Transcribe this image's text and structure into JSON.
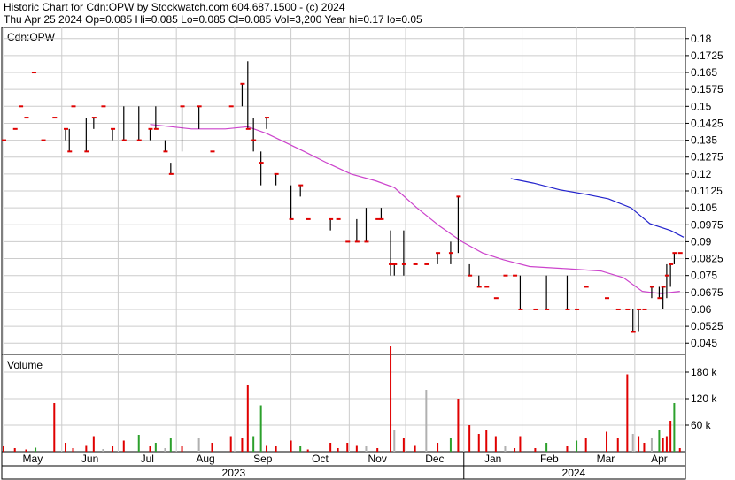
{
  "header": {
    "line1": "Historic Chart for Cdn:OPW by Stockwatch.com 604.687.1500 - (c) 2024",
    "line2": "Thu Apr 25 2024  Op=0.085  Hi=0.085  Lo=0.085  Cl=0.085  Vol=3,200  Year hi=0.17  lo=0.05"
  },
  "price_panel": {
    "symbol_label": "Cdn:OPW"
  },
  "volume_panel": {
    "title": "Volume"
  },
  "colors": {
    "up_volume": "#2ca02c",
    "down_volume": "#e00000",
    "flat_volume": "#b0b0b0",
    "price_bar": "#000000",
    "close_tick": "#e00000",
    "ma_short": "#cc44cc",
    "ma_long": "#2222cc"
  },
  "chart_data": [
    {
      "type": "ohlc",
      "title": "Historic Chart for Cdn:OPW",
      "x_months": [
        "May",
        "Jun",
        "Jul",
        "Aug",
        "Sep",
        "Oct",
        "Nov",
        "Dec",
        "Jan",
        "Feb",
        "Mar",
        "Apr"
      ],
      "x_years": [
        "2023",
        "2024"
      ],
      "y_ticks": [
        "0.18",
        "0.1725",
        "0.165",
        "0.1575",
        "0.15",
        "0.1425",
        "0.135",
        "0.1275",
        "0.12",
        "0.1125",
        "0.105",
        "0.0975",
        "0.09",
        "0.0825",
        "0.075",
        "0.0675",
        "0.06",
        "0.0525",
        "0.045"
      ],
      "ylim": [
        0.04,
        0.185
      ],
      "grid": true,
      "bars": [
        {
          "d": 0,
          "h": 0.135,
          "l": 0.135,
          "c": 0.135
        },
        {
          "d": 6,
          "h": 0.14,
          "l": 0.14,
          "c": 0.14
        },
        {
          "d": 9,
          "h": 0.15,
          "l": 0.15,
          "c": 0.15
        },
        {
          "d": 12,
          "h": 0.145,
          "l": 0.145,
          "c": 0.145
        },
        {
          "d": 16,
          "h": 0.165,
          "l": 0.165,
          "c": 0.165
        },
        {
          "d": 21,
          "h": 0.135,
          "l": 0.135,
          "c": 0.135
        },
        {
          "d": 27,
          "h": 0.145,
          "l": 0.145,
          "c": 0.145
        },
        {
          "d": 33,
          "h": 0.14,
          "l": 0.135,
          "c": 0.14
        },
        {
          "d": 35,
          "h": 0.14,
          "l": 0.13,
          "c": 0.13
        },
        {
          "d": 37,
          "h": 0.15,
          "l": 0.15,
          "c": 0.15
        },
        {
          "d": 44,
          "h": 0.145,
          "l": 0.13,
          "c": 0.13
        },
        {
          "d": 48,
          "h": 0.145,
          "l": 0.14,
          "c": 0.145
        },
        {
          "d": 53,
          "h": 0.15,
          "l": 0.15,
          "c": 0.15
        },
        {
          "d": 58,
          "h": 0.14,
          "l": 0.135,
          "c": 0.14
        },
        {
          "d": 64,
          "h": 0.15,
          "l": 0.135,
          "c": 0.135
        },
        {
          "d": 72,
          "h": 0.15,
          "l": 0.135,
          "c": 0.135
        },
        {
          "d": 78,
          "h": 0.14,
          "l": 0.135,
          "c": 0.14
        },
        {
          "d": 81,
          "h": 0.15,
          "l": 0.14,
          "c": 0.14
        },
        {
          "d": 86,
          "h": 0.135,
          "l": 0.13,
          "c": 0.13
        },
        {
          "d": 89,
          "h": 0.125,
          "l": 0.12,
          "c": 0.12
        },
        {
          "d": 95,
          "h": 0.15,
          "l": 0.13,
          "c": 0.15
        },
        {
          "d": 104,
          "h": 0.15,
          "l": 0.14,
          "c": 0.15
        },
        {
          "d": 111,
          "h": 0.13,
          "l": 0.13,
          "c": 0.13
        },
        {
          "d": 121,
          "h": 0.15,
          "l": 0.15,
          "c": 0.15
        },
        {
          "d": 127,
          "h": 0.16,
          "l": 0.15,
          "c": 0.16
        },
        {
          "d": 130,
          "h": 0.17,
          "l": 0.14,
          "c": 0.14
        },
        {
          "d": 133,
          "h": 0.145,
          "l": 0.13,
          "c": 0.135
        },
        {
          "d": 137,
          "h": 0.13,
          "l": 0.115,
          "c": 0.125
        },
        {
          "d": 140,
          "h": 0.145,
          "l": 0.14,
          "c": 0.145
        },
        {
          "d": 145,
          "h": 0.12,
          "l": 0.115,
          "c": 0.12
        },
        {
          "d": 153,
          "h": 0.115,
          "l": 0.1,
          "c": 0.1
        },
        {
          "d": 158,
          "h": 0.115,
          "l": 0.11,
          "c": 0.115
        },
        {
          "d": 162,
          "h": 0.1,
          "l": 0.1,
          "c": 0.1
        },
        {
          "d": 174,
          "h": 0.1,
          "l": 0.095,
          "c": 0.1
        },
        {
          "d": 178,
          "h": 0.1,
          "l": 0.1,
          "c": 0.1
        },
        {
          "d": 183,
          "h": 0.09,
          "l": 0.09,
          "c": 0.09
        },
        {
          "d": 188,
          "h": 0.1,
          "l": 0.09,
          "c": 0.09
        },
        {
          "d": 193,
          "h": 0.105,
          "l": 0.09,
          "c": 0.09
        },
        {
          "d": 199,
          "h": 0.1,
          "l": 0.1,
          "c": 0.1
        },
        {
          "d": 201,
          "h": 0.105,
          "l": 0.1,
          "c": 0.1
        },
        {
          "d": 206,
          "h": 0.095,
          "l": 0.075,
          "c": 0.08
        },
        {
          "d": 208,
          "h": 0.08,
          "l": 0.075,
          "c": 0.08
        },
        {
          "d": 213,
          "h": 0.095,
          "l": 0.075,
          "c": 0.08
        },
        {
          "d": 219,
          "h": 0.08,
          "l": 0.08,
          "c": 0.08
        },
        {
          "d": 225,
          "h": 0.08,
          "l": 0.08,
          "c": 0.08
        },
        {
          "d": 231,
          "h": 0.085,
          "l": 0.08,
          "c": 0.085
        },
        {
          "d": 238,
          "h": 0.09,
          "l": 0.08,
          "c": 0.085
        },
        {
          "d": 242,
          "h": 0.11,
          "l": 0.085,
          "c": 0.11
        },
        {
          "d": 248,
          "h": 0.08,
          "l": 0.075,
          "c": 0.075
        },
        {
          "d": 253,
          "h": 0.075,
          "l": 0.07,
          "c": 0.07
        },
        {
          "d": 257,
          "h": 0.07,
          "l": 0.07,
          "c": 0.07
        },
        {
          "d": 262,
          "h": 0.065,
          "l": 0.065,
          "c": 0.065
        },
        {
          "d": 267,
          "h": 0.075,
          "l": 0.075,
          "c": 0.075
        },
        {
          "d": 272,
          "h": 0.075,
          "l": 0.075,
          "c": 0.075
        },
        {
          "d": 275,
          "h": 0.075,
          "l": 0.06,
          "c": 0.06
        },
        {
          "d": 283,
          "h": 0.06,
          "l": 0.06,
          "c": 0.06
        },
        {
          "d": 289,
          "h": 0.075,
          "l": 0.06,
          "c": 0.06
        },
        {
          "d": 300,
          "h": 0.075,
          "l": 0.06,
          "c": 0.06
        },
        {
          "d": 305,
          "h": 0.06,
          "l": 0.06,
          "c": 0.06
        },
        {
          "d": 310,
          "h": 0.07,
          "l": 0.07,
          "c": 0.07
        },
        {
          "d": 321,
          "h": 0.065,
          "l": 0.065,
          "c": 0.065
        },
        {
          "d": 327,
          "h": 0.06,
          "l": 0.06,
          "c": 0.06
        },
        {
          "d": 332,
          "h": 0.06,
          "l": 0.06,
          "c": 0.06
        },
        {
          "d": 335,
          "h": 0.06,
          "l": 0.05,
          "c": 0.05
        },
        {
          "d": 338,
          "h": 0.06,
          "l": 0.05,
          "c": 0.06
        },
        {
          "d": 341,
          "h": 0.06,
          "l": 0.06,
          "c": 0.06
        },
        {
          "d": 345,
          "h": 0.07,
          "l": 0.065,
          "c": 0.07
        },
        {
          "d": 349,
          "h": 0.07,
          "l": 0.065,
          "c": 0.065
        },
        {
          "d": 351,
          "h": 0.07,
          "l": 0.06,
          "c": 0.07
        },
        {
          "d": 353,
          "h": 0.08,
          "l": 0.065,
          "c": 0.075
        },
        {
          "d": 355,
          "h": 0.08,
          "l": 0.07,
          "c": 0.08
        },
        {
          "d": 357,
          "h": 0.085,
          "l": 0.08,
          "c": 0.085
        },
        {
          "d": 360,
          "h": 0.085,
          "l": 0.085,
          "c": 0.085
        }
      ],
      "moving_averages": [
        {
          "points": [
            [
              78,
              0.142
            ],
            [
              100,
              0.14
            ],
            [
              118,
              0.14
            ],
            [
              130,
              0.141
            ],
            [
              140,
              0.138
            ],
            [
              150,
              0.134
            ],
            [
              160,
              0.13
            ],
            [
              172,
              0.125
            ],
            [
              185,
              0.12
            ],
            [
              198,
              0.117
            ],
            [
              208,
              0.114
            ],
            [
              220,
              0.105
            ],
            [
              232,
              0.097
            ],
            [
              244,
              0.09
            ],
            [
              255,
              0.085
            ],
            [
              266,
              0.082
            ],
            [
              280,
              0.079
            ],
            [
              300,
              0.078
            ],
            [
              318,
              0.077
            ],
            [
              330,
              0.074
            ],
            [
              340,
              0.068
            ],
            [
              350,
              0.067
            ],
            [
              360,
              0.068
            ]
          ]
        },
        {
          "points": [
            [
              270,
              0.118
            ],
            [
              282,
              0.116
            ],
            [
              296,
              0.113
            ],
            [
              310,
              0.111
            ],
            [
              322,
              0.109
            ],
            [
              334,
              0.105
            ],
            [
              344,
              0.098
            ],
            [
              355,
              0.095
            ],
            [
              362,
              0.092
            ]
          ]
        }
      ]
    },
    {
      "type": "bar",
      "title": "Volume",
      "y_ticks": [
        "180 k",
        "120 k",
        "60 k"
      ],
      "ylim": [
        0,
        220000
      ],
      "bars": [
        {
          "d": 0,
          "v": 12000,
          "k": "down"
        },
        {
          "d": 6,
          "v": 8000,
          "k": "down"
        },
        {
          "d": 12,
          "v": 5000,
          "k": "down"
        },
        {
          "d": 17,
          "v": 9000,
          "k": "up"
        },
        {
          "d": 27,
          "v": 110000,
          "k": "down"
        },
        {
          "d": 33,
          "v": 20000,
          "k": "down"
        },
        {
          "d": 37,
          "v": 8000,
          "k": "down"
        },
        {
          "d": 44,
          "v": 15000,
          "k": "down"
        },
        {
          "d": 48,
          "v": 35000,
          "k": "down"
        },
        {
          "d": 53,
          "v": 6000,
          "k": "flat"
        },
        {
          "d": 58,
          "v": 12000,
          "k": "down"
        },
        {
          "d": 64,
          "v": 25000,
          "k": "down"
        },
        {
          "d": 72,
          "v": 38000,
          "k": "up"
        },
        {
          "d": 78,
          "v": 12000,
          "k": "down"
        },
        {
          "d": 81,
          "v": 20000,
          "k": "up"
        },
        {
          "d": 86,
          "v": 8000,
          "k": "flat"
        },
        {
          "d": 89,
          "v": 30000,
          "k": "up"
        },
        {
          "d": 95,
          "v": 12000,
          "k": "down"
        },
        {
          "d": 104,
          "v": 30000,
          "k": "flat"
        },
        {
          "d": 111,
          "v": 20000,
          "k": "down"
        },
        {
          "d": 121,
          "v": 35000,
          "k": "down"
        },
        {
          "d": 127,
          "v": 30000,
          "k": "down"
        },
        {
          "d": 130,
          "v": 150000,
          "k": "down"
        },
        {
          "d": 133,
          "v": 35000,
          "k": "up"
        },
        {
          "d": 137,
          "v": 105000,
          "k": "up"
        },
        {
          "d": 140,
          "v": 15000,
          "k": "down"
        },
        {
          "d": 145,
          "v": 12000,
          "k": "down"
        },
        {
          "d": 153,
          "v": 25000,
          "k": "down"
        },
        {
          "d": 158,
          "v": 12000,
          "k": "up"
        },
        {
          "d": 162,
          "v": 5000,
          "k": "down"
        },
        {
          "d": 174,
          "v": 20000,
          "k": "down"
        },
        {
          "d": 178,
          "v": 8000,
          "k": "down"
        },
        {
          "d": 183,
          "v": 20000,
          "k": "down"
        },
        {
          "d": 188,
          "v": 15000,
          "k": "down"
        },
        {
          "d": 193,
          "v": 12000,
          "k": "flat"
        },
        {
          "d": 199,
          "v": 8000,
          "k": "down"
        },
        {
          "d": 206,
          "v": 240000,
          "k": "down"
        },
        {
          "d": 208,
          "v": 50000,
          "k": "flat"
        },
        {
          "d": 213,
          "v": 30000,
          "k": "down"
        },
        {
          "d": 219,
          "v": 15000,
          "k": "down"
        },
        {
          "d": 225,
          "v": 140000,
          "k": "flat"
        },
        {
          "d": 231,
          "v": 20000,
          "k": "down"
        },
        {
          "d": 238,
          "v": 30000,
          "k": "up"
        },
        {
          "d": 242,
          "v": 120000,
          "k": "down"
        },
        {
          "d": 248,
          "v": 60000,
          "k": "down"
        },
        {
          "d": 253,
          "v": 40000,
          "k": "down"
        },
        {
          "d": 257,
          "v": 50000,
          "k": "down"
        },
        {
          "d": 262,
          "v": 35000,
          "k": "down"
        },
        {
          "d": 267,
          "v": 12000,
          "k": "flat"
        },
        {
          "d": 272,
          "v": 8000,
          "k": "down"
        },
        {
          "d": 275,
          "v": 35000,
          "k": "down"
        },
        {
          "d": 283,
          "v": 8000,
          "k": "down"
        },
        {
          "d": 289,
          "v": 20000,
          "k": "up"
        },
        {
          "d": 300,
          "v": 12000,
          "k": "down"
        },
        {
          "d": 305,
          "v": 25000,
          "k": "up"
        },
        {
          "d": 310,
          "v": 30000,
          "k": "down"
        },
        {
          "d": 321,
          "v": 45000,
          "k": "down"
        },
        {
          "d": 327,
          "v": 30000,
          "k": "down"
        },
        {
          "d": 332,
          "v": 175000,
          "k": "down"
        },
        {
          "d": 335,
          "v": 40000,
          "k": "flat"
        },
        {
          "d": 338,
          "v": 35000,
          "k": "down"
        },
        {
          "d": 341,
          "v": 20000,
          "k": "down"
        },
        {
          "d": 345,
          "v": 30000,
          "k": "flat"
        },
        {
          "d": 349,
          "v": 50000,
          "k": "up"
        },
        {
          "d": 351,
          "v": 30000,
          "k": "down"
        },
        {
          "d": 353,
          "v": 35000,
          "k": "down"
        },
        {
          "d": 355,
          "v": 70000,
          "k": "down"
        },
        {
          "d": 357,
          "v": 110000,
          "k": "up"
        },
        {
          "d": 360,
          "v": 8000,
          "k": "down"
        }
      ]
    }
  ]
}
